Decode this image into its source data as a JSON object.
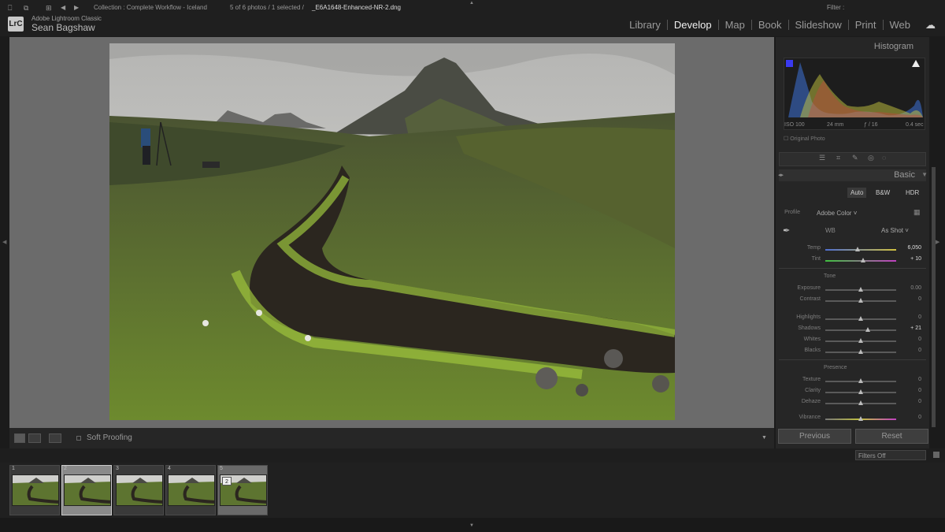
{
  "app": {
    "name": "Adobe Lightroom Classic",
    "logo": "LrC",
    "user": "Sean Bagshaw"
  },
  "modules": [
    {
      "label": "Library",
      "active": false
    },
    {
      "label": "Develop",
      "active": true
    },
    {
      "label": "Map",
      "active": false
    },
    {
      "label": "Book",
      "active": false
    },
    {
      "label": "Slideshow",
      "active": false
    },
    {
      "label": "Print",
      "active": false
    },
    {
      "label": "Web",
      "active": false
    }
  ],
  "toolbar": {
    "soft_proofing": "Soft Proofing"
  },
  "histogram": {
    "title": "Histogram",
    "iso": "ISO 100",
    "focal": "24 mm",
    "aperture": "ƒ / 16",
    "shutter": "0.4 sec",
    "original_photo": "Original Photo"
  },
  "basic": {
    "title": "Basic",
    "treatment_buttons": [
      "Auto",
      "B&W",
      "HDR"
    ],
    "profile_label": "Profile",
    "profile_value": "Adobe Color",
    "wb_label": "WB",
    "wb_value": "As Shot",
    "tone_label": "Tone",
    "presence_label": "Presence",
    "sliders": [
      {
        "label": "Temp",
        "value": "6,050",
        "pos": 0.45
      },
      {
        "label": "Tint",
        "value": "+ 10",
        "pos": 0.53
      },
      {
        "label": "Exposure",
        "value": "0.00",
        "pos": 0.5
      },
      {
        "label": "Contrast",
        "value": "0",
        "pos": 0.5
      },
      {
        "label": "Highlights",
        "value": "0",
        "pos": 0.5
      },
      {
        "label": "Shadows",
        "value": "+ 21",
        "pos": 0.6
      },
      {
        "label": "Whites",
        "value": "0",
        "pos": 0.5
      },
      {
        "label": "Blacks",
        "value": "0",
        "pos": 0.5
      },
      {
        "label": "Texture",
        "value": "0",
        "pos": 0.5
      },
      {
        "label": "Clarity",
        "value": "0",
        "pos": 0.5
      },
      {
        "label": "Dehaze",
        "value": "0",
        "pos": 0.5
      },
      {
        "label": "Vibrance",
        "value": "0",
        "pos": 0.5
      }
    ],
    "previous": "Previous",
    "reset": "Reset"
  },
  "info": {
    "collection": "Collection : Complete Workflow - Iceland",
    "count": "5 of 6 photos / 1 selected /",
    "filename": "_E6A1648-Enhanced-NR-2.dng",
    "filter_label": "Filter :",
    "filter_value": "Filters Off"
  },
  "filmstrip": [
    {
      "num": "1",
      "badge": "",
      "state": "normal"
    },
    {
      "num": "2",
      "badge": "",
      "state": "selected"
    },
    {
      "num": "3",
      "badge": "",
      "state": "normal"
    },
    {
      "num": "4",
      "badge": "",
      "state": "normal"
    },
    {
      "num": "5",
      "badge": "2",
      "state": "hover"
    }
  ]
}
